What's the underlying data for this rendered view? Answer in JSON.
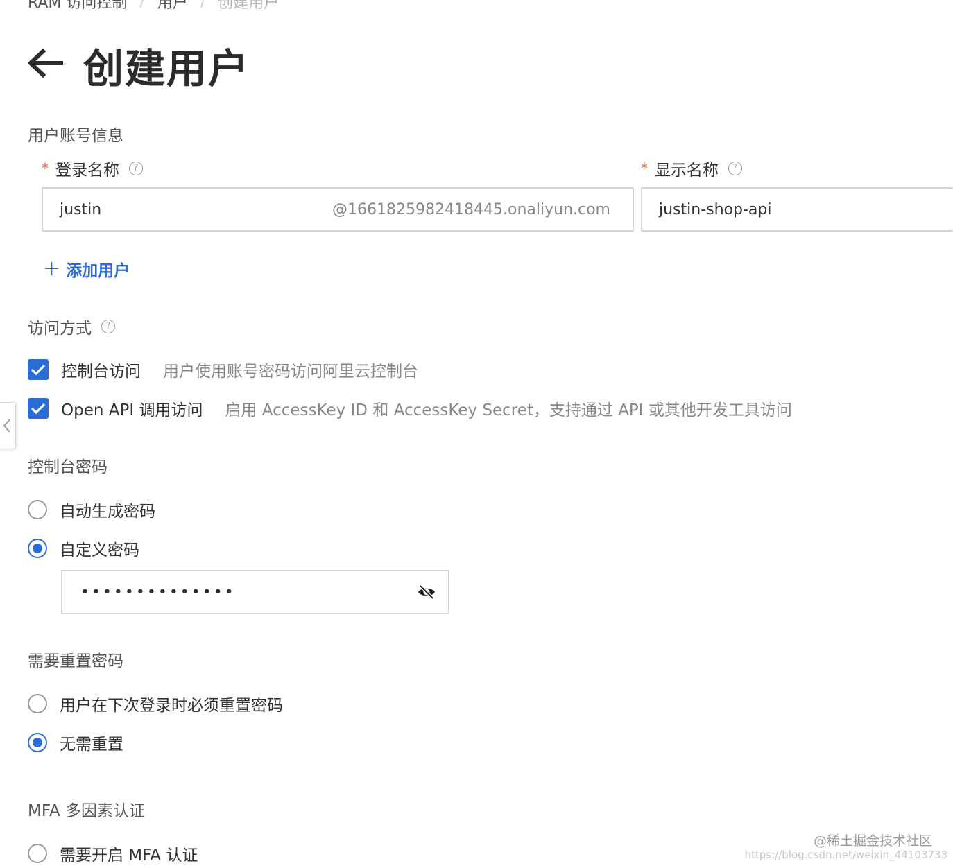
{
  "breadcrumb": {
    "items": [
      "RAM 访问控制",
      "用户",
      "创建用户"
    ],
    "separator": "/"
  },
  "header": {
    "title": "创建用户",
    "back_icon": "arrow-left-icon"
  },
  "account_info": {
    "section_title": "用户账号信息",
    "login_name": {
      "label": "登录名称",
      "required_mark": "*",
      "value": "justin",
      "suffix": "@1661825982418445.onaliyun.com"
    },
    "display_name": {
      "label": "显示名称",
      "required_mark": "*",
      "value": "justin-shop-api"
    },
    "help_glyph": "?",
    "add_user": {
      "plus": "+",
      "label": "添加用户"
    }
  },
  "access": {
    "section_title": "访问方式",
    "console": {
      "label": "控制台访问",
      "desc": "用户使用账号密码访问阿里云控制台",
      "checked": true
    },
    "api": {
      "label": "Open API 调用访问",
      "desc": "启用 AccessKey ID 和 AccessKey Secret，支持通过 API 或其他开发工具访问",
      "checked": true
    }
  },
  "console_password": {
    "section_title": "控制台密码",
    "auto": {
      "label": "自动生成密码",
      "selected": false
    },
    "custom": {
      "label": "自定义密码",
      "selected": true
    },
    "masked_value": "••••••••••••••",
    "eye_icon": "eye-off-icon"
  },
  "reset_password": {
    "section_title": "需要重置密码",
    "must_reset": {
      "label": "用户在下次登录时必须重置密码",
      "selected": false
    },
    "no_reset": {
      "label": "无需重置",
      "selected": true
    }
  },
  "mfa": {
    "section_title": "MFA 多因素认证",
    "enable": {
      "label": "需要开启 MFA 认证",
      "selected": false
    }
  },
  "watermark": {
    "text": "@稀土掘金技术社区",
    "url": "https://blog.csdn.net/weixin_44103733"
  },
  "colors": {
    "primary": "#2b6dd6",
    "required": "#e8604c",
    "muted_text": "#888888"
  }
}
